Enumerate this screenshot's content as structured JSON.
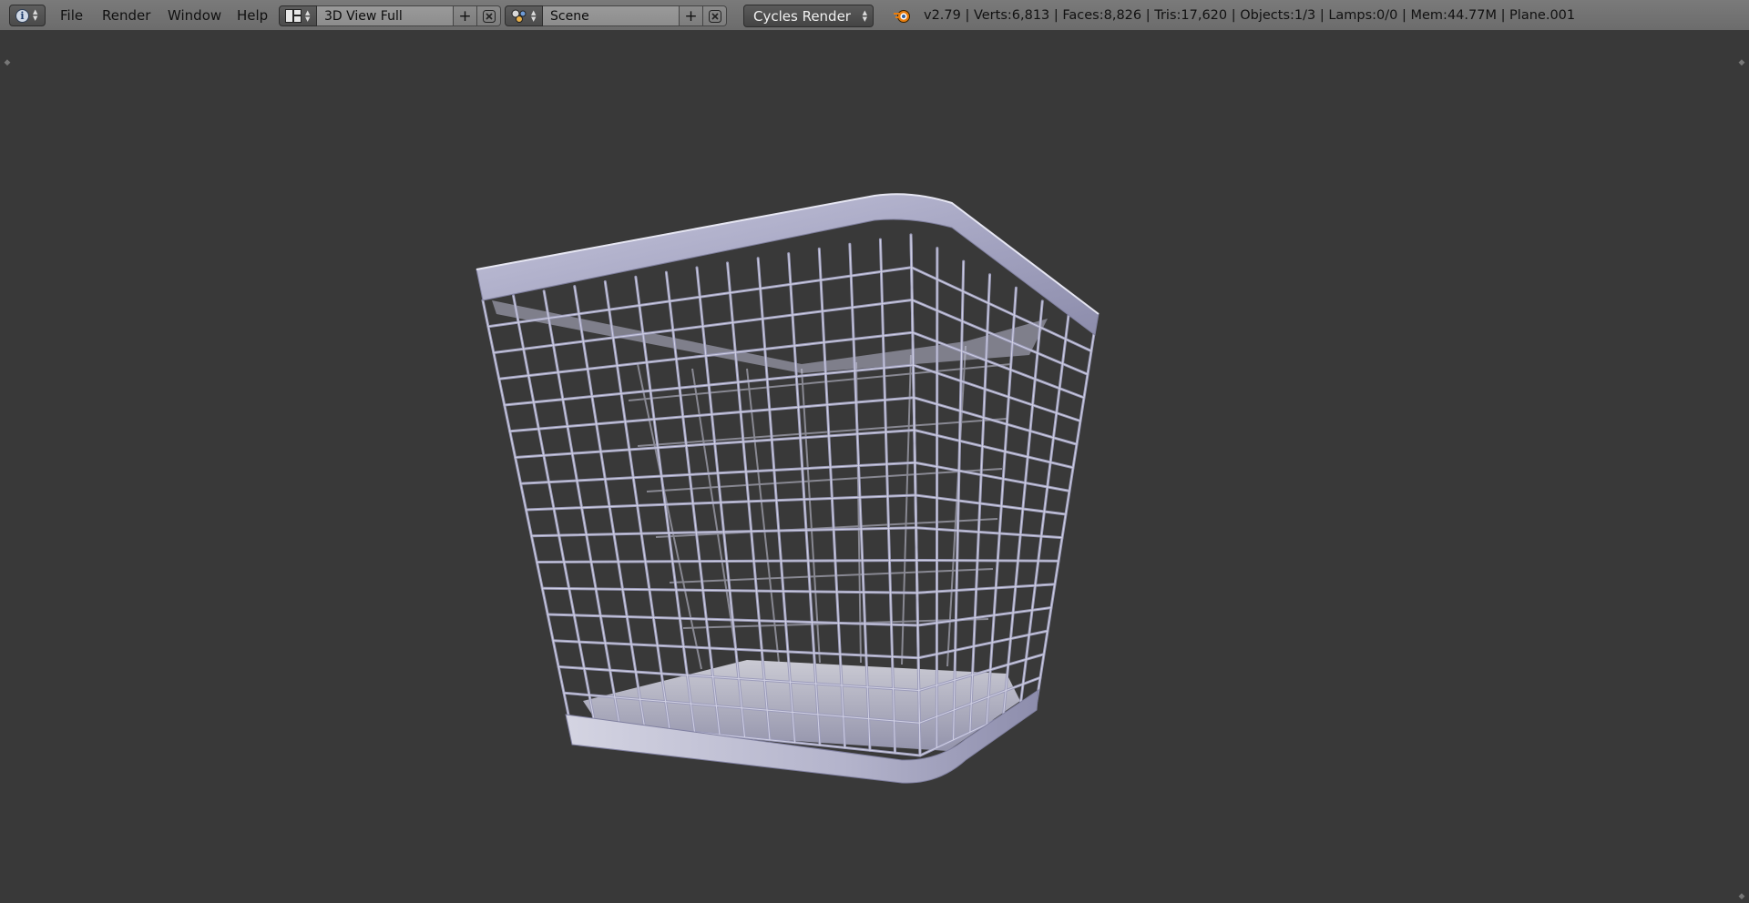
{
  "menus": [
    "File",
    "Render",
    "Window",
    "Help"
  ],
  "layout": {
    "name": "3D View Full"
  },
  "scene": {
    "name": "Scene"
  },
  "render_engine": "Cycles Render",
  "stats": "v2.79 | Verts:6,813 | Faces:8,826 | Tris:17,620 | Objects:1/3 | Lamps:0/0 | Mem:44.77M | Plane.001",
  "icons": {
    "editor_type": "info-icon",
    "layout": "screen-layout-icon",
    "scene": "scene-icon",
    "add": "plus-icon",
    "remove": "x-icon",
    "logo": "blender-logo-icon"
  },
  "colors": {
    "header": "#737373",
    "viewport": "#393939",
    "mesh": "#a9a9c6"
  }
}
